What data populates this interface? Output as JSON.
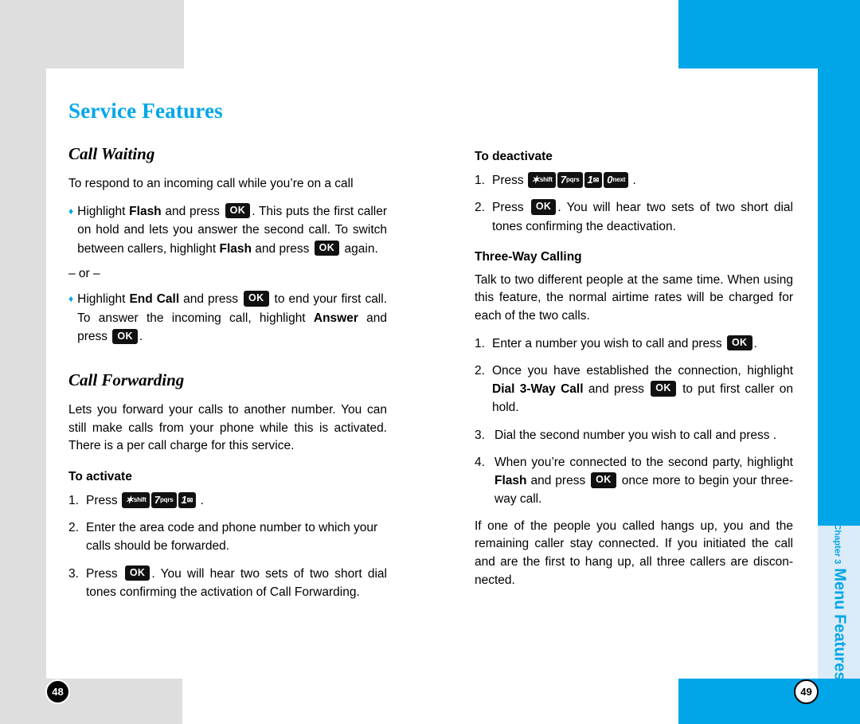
{
  "document": {
    "title": "Service Features",
    "chapter_tab": {
      "chapter": "Chapter 3",
      "title": "Menu Features"
    },
    "page_left": "48",
    "page_right": "49",
    "accent_color": "#00a6e8",
    "gray_color": "#dedede",
    "tab_color": "#dcebf8"
  },
  "keys": {
    "ok": "OK",
    "star_shift": {
      "glyph": "✶",
      "sub": "shift"
    },
    "seven_pqrs": {
      "glyph": "7",
      "sub": "pqrs"
    },
    "one_mail": {
      "glyph": "1",
      "sub": "✉"
    },
    "zero_next": {
      "glyph": "0",
      "sub": "next"
    }
  },
  "left_column": {
    "call_waiting": {
      "heading": "Call Waiting",
      "intro": "To respond to an incoming call while you’re on a call",
      "bullet1": {
        "marker": "♦",
        "part1": "Highlight ",
        "bold1": "Flash",
        "part2": " and press ",
        "part3": ". This puts the first caller on hold and lets you answer the second call. To switch between callers, highlight ",
        "bold2": "Flash",
        "part4": " and press ",
        "part5": " again."
      },
      "or": "– or –",
      "bullet2": {
        "marker": "♦",
        "part1": "Highlight ",
        "bold1": "End Call",
        "part2": " and press ",
        "part3": " to end your first call. To answer the incoming call, highlight ",
        "bold2": "Answer",
        "part4": " and press ",
        "part5": "."
      }
    },
    "call_forwarding": {
      "heading": "Call Forwarding",
      "intro": "Lets you forward your calls to another number. You can still make calls from your phone while this is activated. There is a per call charge for this service.",
      "to_activate": "To activate",
      "steps": [
        {
          "num": "1.",
          "pre": "Press ",
          "post": " ."
        },
        {
          "num": "2.",
          "text": "Enter the area code and phone number to which your calls should be forwarded."
        },
        {
          "num": "3.",
          "pre": "Press ",
          "post": ". You will hear two sets of two short dial tones confirming the activation of Call Forwarding."
        }
      ]
    }
  },
  "right_column": {
    "to_deactivate": {
      "heading": "To deactivate",
      "steps": [
        {
          "num": "1.",
          "pre": "Press ",
          "post": " ."
        },
        {
          "num": "2.",
          "pre": "Press ",
          "post": ". You will hear two sets of two short dial tones confirming the deactivation."
        }
      ]
    },
    "three_way": {
      "heading": "Three-Way Calling",
      "intro": "Talk to two different people at the same time. When using this feature, the normal airtime rates will be charged for each of the two calls.",
      "steps": [
        {
          "num": "1.",
          "pre": "Enter a number you wish to call and press ",
          "post": "."
        },
        {
          "num": "2.",
          "pre": "Once you have established the connection, highlight ",
          "bold": "Dial 3-Way Call",
          "mid": " and press ",
          "post": " to put first caller on hold."
        },
        {
          "num": "3.",
          "text": "Dial the second number you wish to call and press ."
        },
        {
          "num": "4.",
          "pre": "When you’re connected to the second party, highlight ",
          "bold": "Flash",
          "mid": " and press ",
          "post": " once more to begin your three-way call."
        }
      ],
      "outro": "If one of the people you called hangs up, you and the remaining caller stay connected. If you initiated the call and are the first to hang up, all three callers are discon-nected."
    }
  }
}
